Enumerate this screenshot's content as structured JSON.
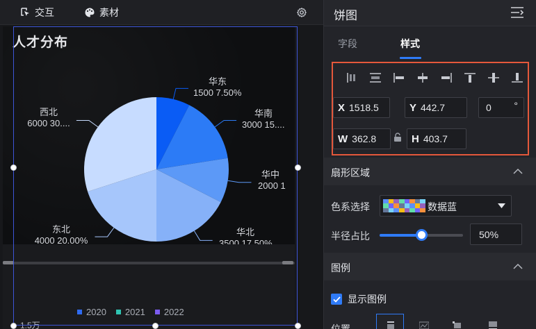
{
  "toolbar": {
    "interact_label": "交互",
    "material_label": "素材"
  },
  "chart": {
    "title": "人才分布",
    "colors": {
      "华东": "#0a5cf5",
      "华南": "#2c7bf6",
      "华中": "#5c99f7",
      "华北": "#86b1f8",
      "东北": "#a6c6fb",
      "西北": "#c7dcff"
    }
  },
  "chart_data": {
    "type": "pie",
    "slices": [
      {
        "name": "华东",
        "value": 1500,
        "label": "1500 7.50%"
      },
      {
        "name": "华南",
        "value": 3000,
        "label": "3000 15...."
      },
      {
        "name": "华中",
        "value": 2000,
        "label": "2000 1"
      },
      {
        "name": "华北",
        "value": 3500,
        "label": "3500 17.50%"
      },
      {
        "name": "东北",
        "value": 4000,
        "label": "4000 20.00%"
      },
      {
        "name": "西北",
        "value": 6000,
        "label": "6000 30...."
      }
    ]
  },
  "legend": {
    "items": [
      {
        "label": "2020",
        "color": "#2f6bf0"
      },
      {
        "label": "2021",
        "color": "#2fc4b2"
      },
      {
        "label": "2022",
        "color": "#7c5cf0"
      }
    ]
  },
  "bottom_note": "1.5万",
  "panel": {
    "title": "饼图",
    "tabs": [
      {
        "label": "字段"
      },
      {
        "label": "样式"
      }
    ],
    "layout": {
      "x_label": "X",
      "x_value": "1518.5",
      "y_label": "Y",
      "y_value": "442.7",
      "rotation_value": "0",
      "rotation_unit": "°",
      "w_label": "W",
      "w_value": "362.8",
      "h_label": "H",
      "h_value": "403.7"
    },
    "sector": {
      "heading": "扇形区域",
      "colors_label": "色系选择",
      "palette_name": "数据蓝",
      "palette_colors": [
        "#5b8ff9",
        "#61ddaa",
        "#65789b",
        "#f6bd16",
        "#7262fd",
        "#78d3f8",
        "#9661bc",
        "#f6903d"
      ],
      "radius_label": "半径占比",
      "radius_value": "50%",
      "radius_fraction": 0.5
    },
    "legend_section": {
      "heading": "图例",
      "show_label": "显示图例",
      "show_checked": true,
      "position_label": "位置"
    }
  }
}
